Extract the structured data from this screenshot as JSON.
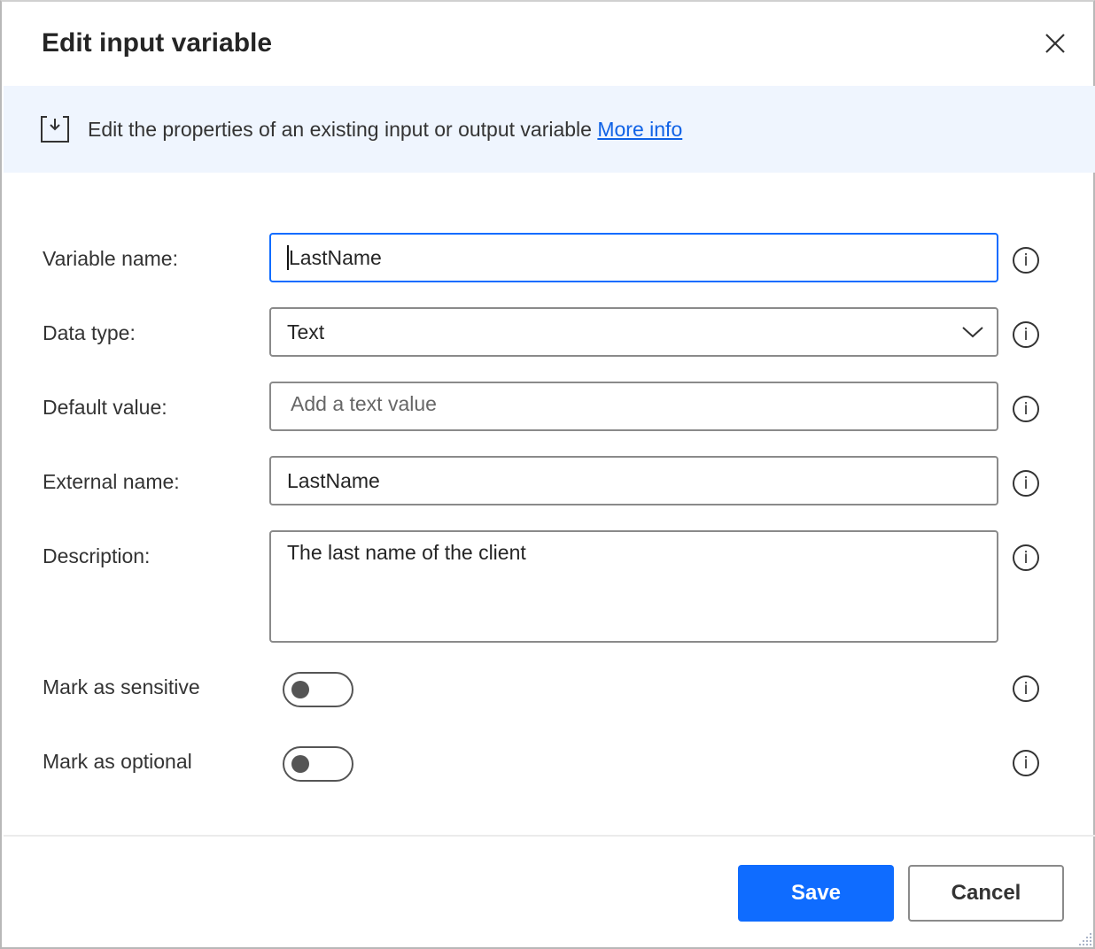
{
  "dialog": {
    "title": "Edit input variable"
  },
  "banner": {
    "text": "Edit the properties of an existing input or output variable ",
    "link": "More info"
  },
  "fields": {
    "variable_name": {
      "label": "Variable name:",
      "value": "LastName"
    },
    "data_type": {
      "label": "Data type:",
      "value": "Text"
    },
    "default_value": {
      "label": "Default value:",
      "placeholder": "Add a text value"
    },
    "external_name": {
      "label": "External name:",
      "value": "LastName"
    },
    "description": {
      "label": "Description:",
      "value": "The last name of the client"
    },
    "sensitive": {
      "label": "Mark as sensitive",
      "on": false
    },
    "optional": {
      "label": "Mark as optional",
      "on": false
    }
  },
  "info_glyph": "i",
  "footer": {
    "save": "Save",
    "cancel": "Cancel"
  },
  "colors": {
    "accent": "#0f6cff",
    "banner_bg": "#eff5fe",
    "link": "#0f62e6"
  }
}
